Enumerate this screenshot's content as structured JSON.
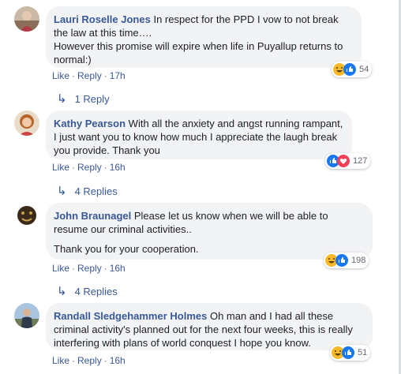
{
  "actions": {
    "like": "Like",
    "reply": "Reply",
    "separator": "·"
  },
  "comments": [
    {
      "author": "Lauri Roselle Jones",
      "lines": [
        "In respect for the PPD I vow to not break the law at this time….",
        "However this promise will expire when life in Puyallup returns to normal:)"
      ],
      "time": "17h",
      "reaction_count": "54",
      "reactions": [
        "haha-icon",
        "like-icon"
      ],
      "replies_label": "1 Reply"
    },
    {
      "author": "Kathy Pearson",
      "lines": [
        "With all the anxiety and angst running rampant, I just want you to know how much I appreciate the laugh break you provide. Thank you"
      ],
      "time": "16h",
      "reaction_count": "127",
      "reactions": [
        "like-icon",
        "love-icon"
      ],
      "replies_label": "4 Replies"
    },
    {
      "author": "John Braunagel",
      "lines": [
        "Please let us know when we will be able to resume our criminal activities..",
        "Thank you for your cooperation."
      ],
      "time": "16h",
      "reaction_count": "198",
      "reactions": [
        "haha-icon",
        "like-icon"
      ],
      "replies_label": "4 Replies"
    },
    {
      "author": "Randall Sledgehammer Holmes",
      "lines": [
        "Oh man and I had all these criminal activity's planned out for the next four weeks, this is really interfering with plans of world conquest I hope you know."
      ],
      "time": "16h",
      "reaction_count": "51",
      "reactions": [
        "haha-icon",
        "like-icon"
      ]
    }
  ],
  "colors": {
    "link": "#385898",
    "bubble": "#f2f3f5",
    "like": "#1877f2",
    "love": "#f33e58",
    "haha": "#f7b928"
  }
}
